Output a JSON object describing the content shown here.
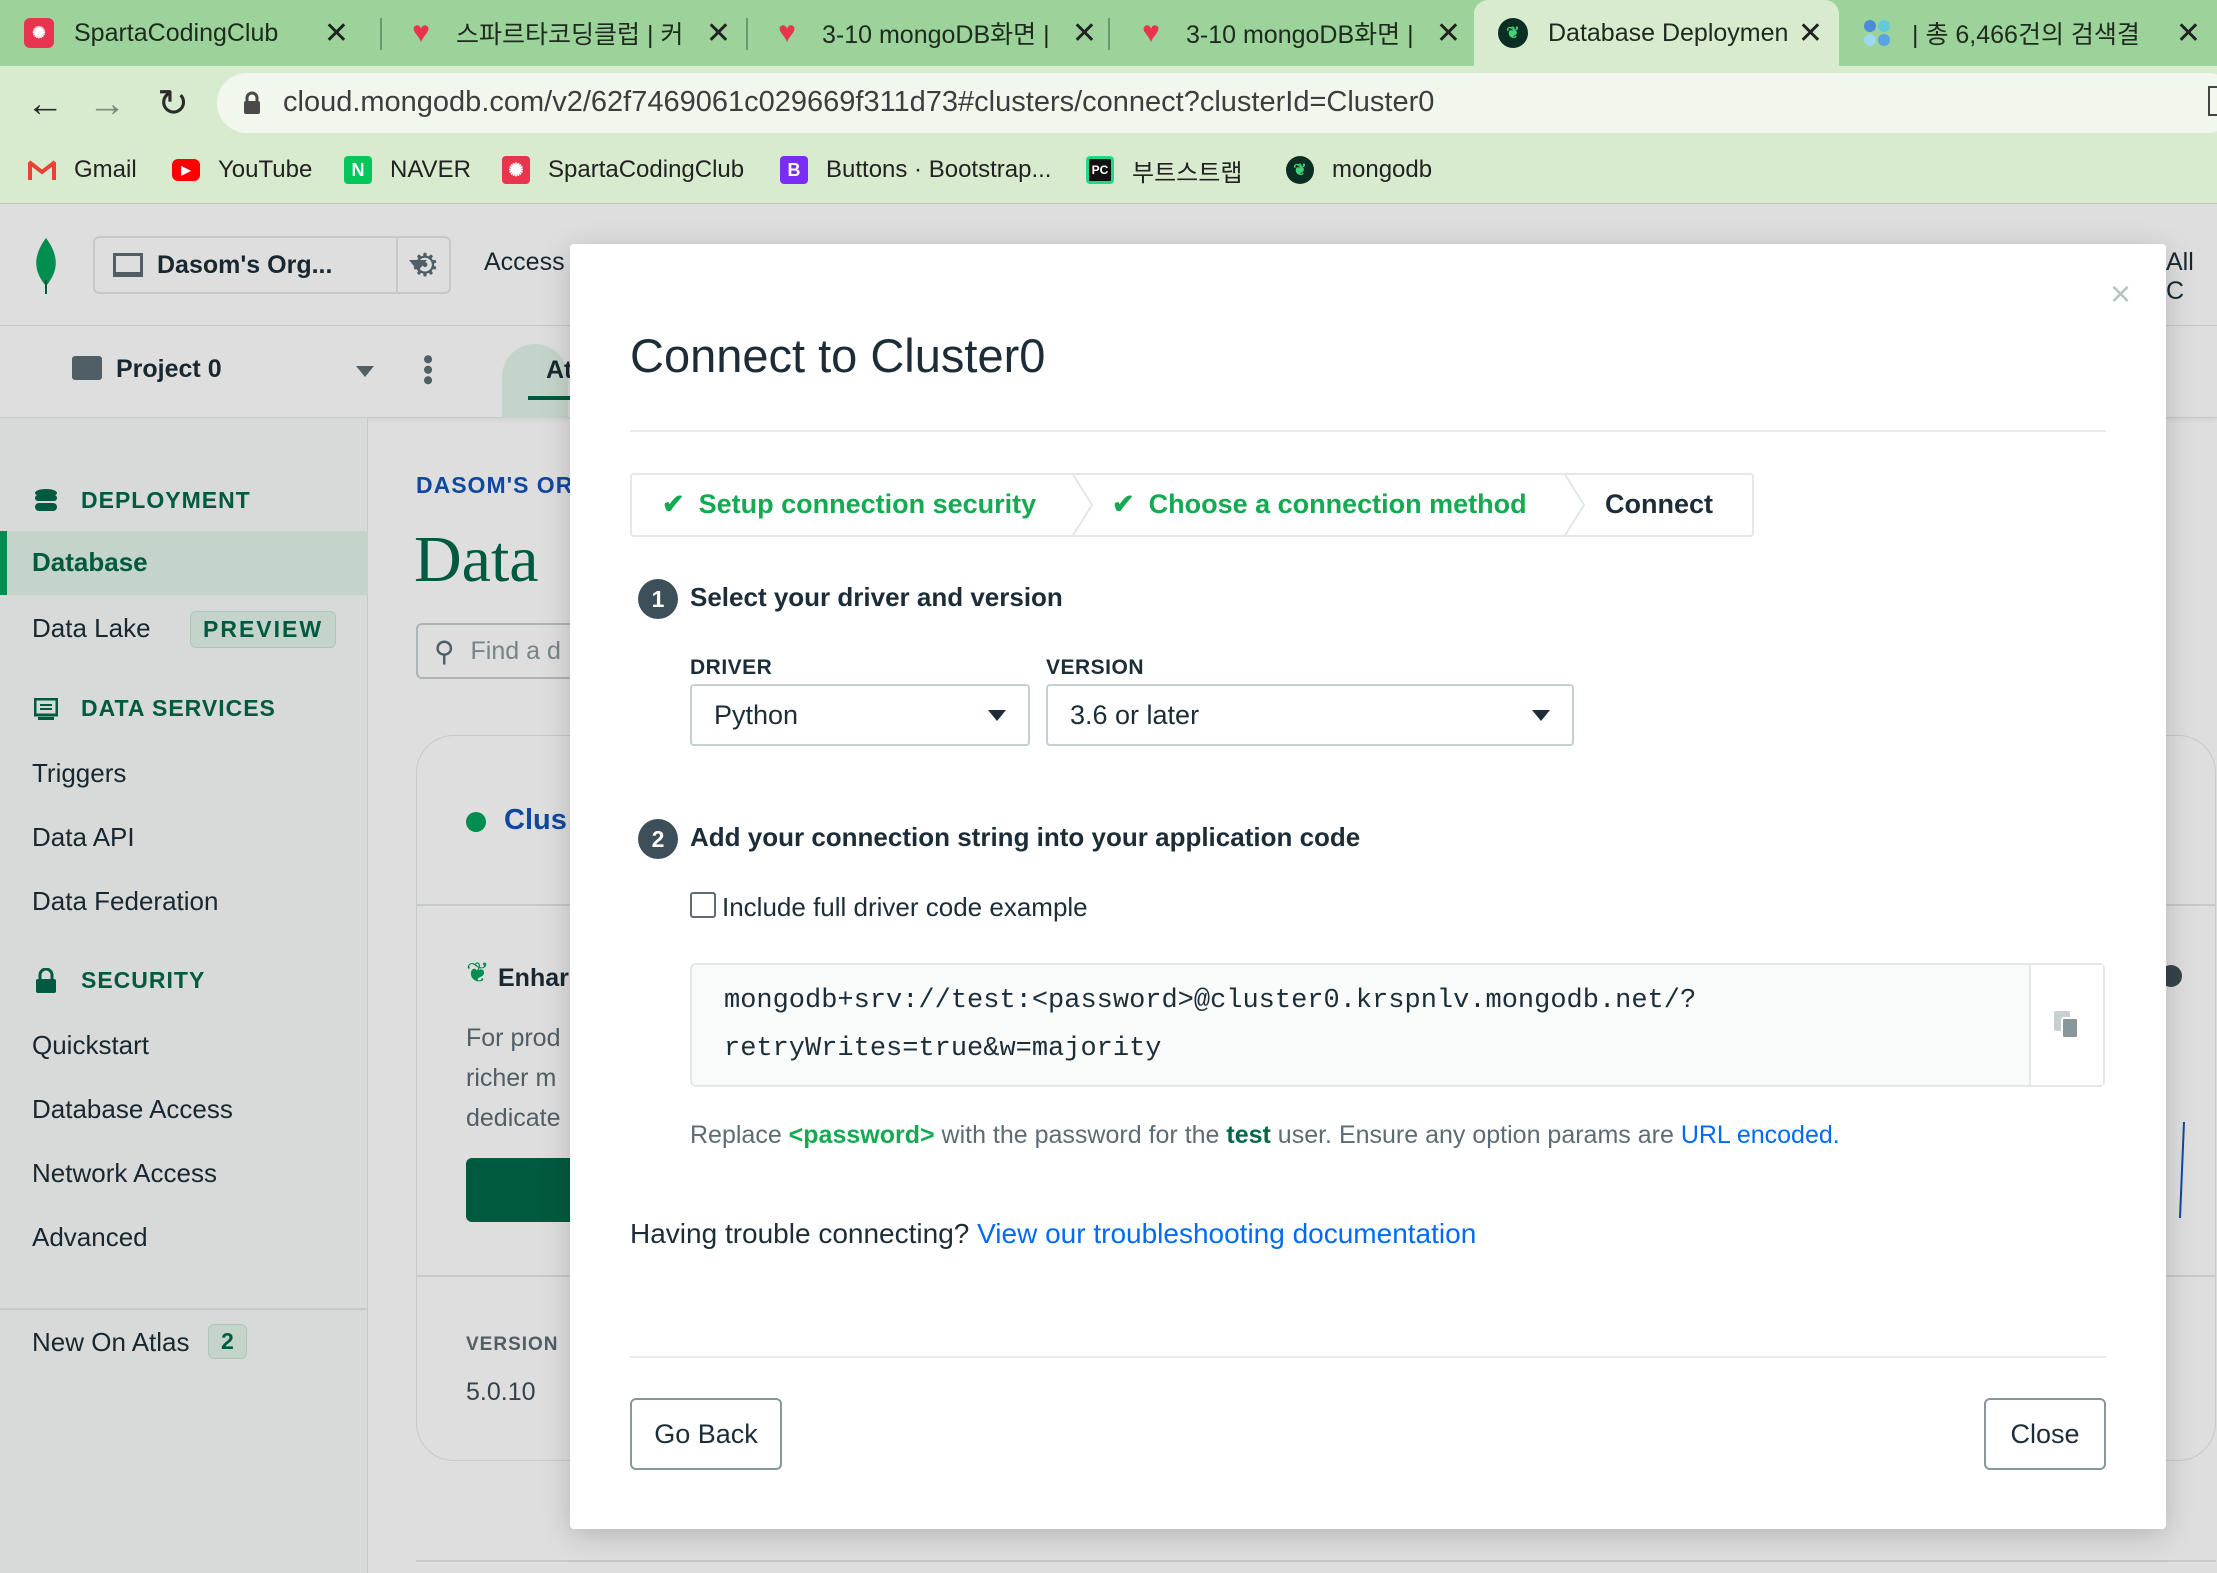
{
  "browser": {
    "tabs": [
      {
        "title": "SpartaCodingClub",
        "icon": "sparta-icon",
        "color": "#e8344e"
      },
      {
        "title": "스파르타코딩클럽 | 커",
        "icon": "sparta-heart-icon",
        "color": "#e8344e"
      },
      {
        "title": "3-10 mongoDB화면 |",
        "icon": "sparta-heart-icon",
        "color": "#e8344e"
      },
      {
        "title": "3-10 mongoDB화면 |",
        "icon": "sparta-heart-icon",
        "color": "#e8344e"
      },
      {
        "title": "Database Deploymen",
        "icon": "mongodb-leaf-icon",
        "color": "#00684a",
        "active": true
      },
      {
        "title": "| 총 6,466건의 검색결",
        "icon": "dots-icon",
        "color": "#4b8bd9"
      }
    ],
    "tab_close": "✕",
    "address": "cloud.mongodb.com/v2/62f7469061c029669f311d73#clusters/connect?clusterId=Cluster0",
    "bookmarks": [
      {
        "label": "Gmail",
        "icon": "gmail-icon"
      },
      {
        "label": "YouTube",
        "icon": "youtube-icon"
      },
      {
        "label": "NAVER",
        "icon": "naver-icon"
      },
      {
        "label": "SpartaCodingClub",
        "icon": "sparta-icon"
      },
      {
        "label": "Buttons · Bootstrap...",
        "icon": "bootstrap-icon"
      },
      {
        "label": "부트스트랩",
        "icon": "pycharm-icon"
      },
      {
        "label": "mongodb",
        "icon": "mongodb-leaf-icon"
      }
    ]
  },
  "app": {
    "org_name": "Dasom's Org...",
    "access_label": "Access",
    "all_label": "All C",
    "project_name": "Project 0",
    "atlas_tab": "At",
    "breadcrumb": "DASOM'S ORG",
    "page_heading": "Data",
    "search_placeholder": "Find a d",
    "sidebar": {
      "deployment": "DEPLOYMENT",
      "database": "Database",
      "data_lake": "Data Lake",
      "preview_badge": "PREVIEW",
      "data_services": "DATA SERVICES",
      "triggers": "Triggers",
      "data_api": "Data API",
      "data_federation": "Data Federation",
      "security": "SECURITY",
      "quickstart": "Quickstart",
      "database_access": "Database Access",
      "network_access": "Network Access",
      "advanced": "Advanced",
      "new_on_atlas": "New On Atlas",
      "new_on_atlas_count": "2"
    },
    "card": {
      "cluster": "Clus",
      "enhance": "Enhar",
      "line1": "For prod",
      "line2": "richer m",
      "line3": "dedicate",
      "version_label": "VERSION",
      "version_value": "5.0.10"
    }
  },
  "modal": {
    "title": "Connect to Cluster0",
    "close_glyph": "×",
    "steps": [
      {
        "label": "Setup connection security",
        "done": true
      },
      {
        "label": "Choose a connection method",
        "done": true
      },
      {
        "label": "Connect",
        "done": false
      }
    ],
    "check_glyph": "✔",
    "section1": {
      "number": "1",
      "title": "Select your driver and version"
    },
    "driver_label": "DRIVER",
    "driver_value": "Python",
    "version_label": "VERSION",
    "version_value": "3.6 or later",
    "section2": {
      "number": "2",
      "title": "Add your connection string into your application code"
    },
    "checkbox_label": "Include full driver code example",
    "checkbox_checked": false,
    "connection_string_line1": "mongodb+srv://test:<password>@cluster0.krspnlv.mongodb.net/?",
    "connection_string_line2": "retryWrites=true&w=majority",
    "hint": {
      "prefix": "Replace ",
      "password": "<password>",
      "middle": " with the password for the ",
      "user": "test",
      "suffix": " user. Ensure any option params are ",
      "link": "URL encoded",
      "end": "."
    },
    "trouble_text": "Having trouble connecting?",
    "trouble_link": "View our troubleshooting documentation",
    "go_back": "Go Back",
    "close": "Close"
  },
  "colors": {
    "mongodb_green": "#00684a",
    "success_green": "#13aa52",
    "link_blue": "#016bf8",
    "chrome_green": "#9bd39a"
  }
}
